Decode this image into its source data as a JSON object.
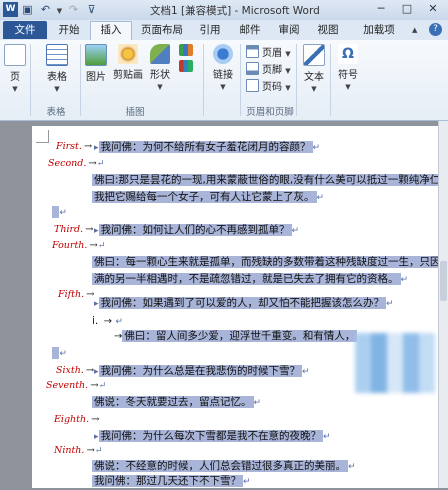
{
  "titlebar": {
    "title": "文档1 [兼容模式] - Microsoft Word"
  },
  "tabs": [
    "文件",
    "开始",
    "插入",
    "页面布局",
    "引用",
    "邮件",
    "审阅",
    "视图",
    "加载项"
  ],
  "ribbon": {
    "page_label": "页",
    "table_label": "表格",
    "picture_label": "图片",
    "clipart_label": "剪贴画",
    "shapes_label": "形状",
    "link_label": "链接",
    "header_label": "页眉",
    "footer_label": "页脚",
    "pagenum_label": "页码",
    "text_label": "文本",
    "symbol_label": "符号",
    "groups": {
      "tables": "表格",
      "illustrations": "插图",
      "header_footer": "页眉和页脚"
    }
  },
  "document": {
    "lines": [
      {
        "label": "First.",
        "text": "我问佛：为何不给所有女子羞花闭月的容颜？"
      },
      {
        "label": "Second.",
        "text": ""
      },
      {
        "text": "佛曰:那只是昙花的一现,用来蒙蔽世俗的眼,没有什么美可以抵过一颗纯净仁"
      },
      {
        "text": "我把它赐给每一个女子，可有人让它蒙上了灰。"
      },
      {
        "label": "Third.",
        "text": "我问佛：如何让人们的心不再感到孤单？"
      },
      {
        "label": "Fourth.",
        "text": ""
      },
      {
        "text": "佛曰：每一颗心生来就是孤单，而残缺的多数带着这种残缺度过一生，只因与"
      },
      {
        "text": "满的另一半相遇时，不是疏忽错过，就是已失去了拥有它的资格。"
      },
      {
        "label": "Fifth.",
        "text": "我问佛：如果遇到了可以爱的人，却又怕不能把握该怎么办？"
      },
      {
        "list_marker": "i.",
        "text": ""
      },
      {
        "text": "佛曰：留人间多少爱，迎浮世千重变。和有情人，"
      },
      {
        "label": "Sixth.",
        "text": "我问佛：为什么总是在我悲伤的时候下雪？"
      },
      {
        "label": "Seventh.",
        "text": ""
      },
      {
        "text": "佛说：冬天就要过去，留点记忆。"
      },
      {
        "label": "Eighth.",
        "text": "我问佛：为什么每次下雪都是我不在意的夜晚？"
      },
      {
        "label": "Ninth.",
        "text": ""
      },
      {
        "text": "佛说：不经意的时候，人们总会错过很多真正的美丽。"
      },
      {
        "text": "我问佛：那过几天还下不下雪？"
      }
    ]
  }
}
